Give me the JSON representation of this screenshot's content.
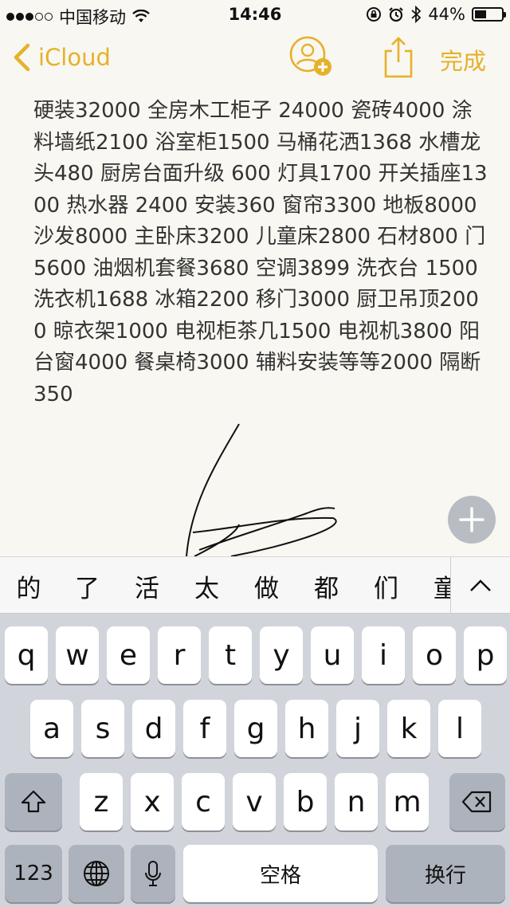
{
  "status_bar": {
    "carrier": "中国移动",
    "time": "14:46",
    "battery": "44%",
    "battery_level": 0.44
  },
  "nav": {
    "back_label": "iCloud",
    "done_label": "完成"
  },
  "note": {
    "text": "硬装32000 全房木工柜子 24000 瓷砖4000 涂料墙纸2100 浴室柜1500 马桶花洒1368 水槽龙头480 厨房台面升级 600 灯具1700 开关插座1300 热水器 2400 安装360 窗帘3300 地板8000 沙发8000 主卧床3200 儿童床2800 石材800 门5600 油烟机套餐3680 空调3899 洗衣台 1500 洗衣机1688 冰箱2200 移门3000 厨卫吊顶2000 晾衣架1000 电视柜茶几1500  电视机3800 阳台窗4000 餐桌椅3000 辅料安装等等2000  隔断350"
  },
  "candidates": [
    "的",
    "了",
    "活",
    "太",
    "做",
    "都",
    "们",
    "童"
  ],
  "keyboard": {
    "row1": [
      "q",
      "w",
      "e",
      "r",
      "t",
      "y",
      "u",
      "i",
      "o",
      "p"
    ],
    "row2": [
      "a",
      "s",
      "d",
      "f",
      "g",
      "h",
      "j",
      "k",
      "l"
    ],
    "row3": [
      "z",
      "x",
      "c",
      "v",
      "b",
      "n",
      "m"
    ],
    "numbers_label": "123",
    "space_label": "空格",
    "return_label": "换行"
  },
  "colors": {
    "accent": "#e6b12a",
    "keyboard_bg": "#d1d5db",
    "paper": "#f8f7f2"
  }
}
